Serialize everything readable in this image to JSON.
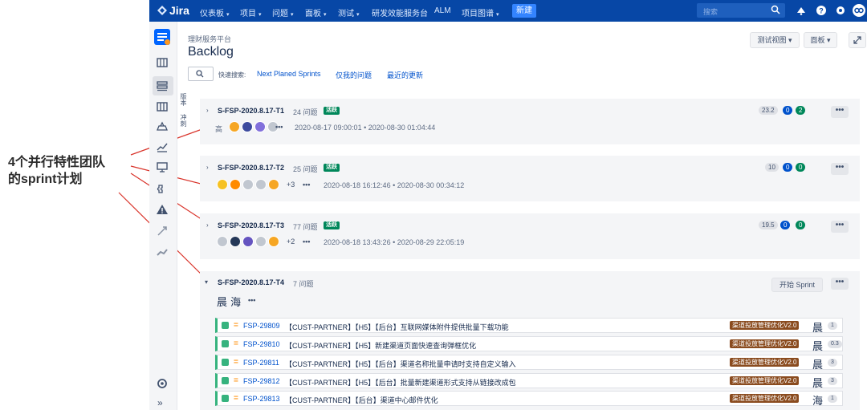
{
  "nav": {
    "logo": "Jira",
    "items": [
      "仪表板",
      "项目",
      "问题",
      "面板",
      "测试",
      "研发效能服务台",
      "ALM",
      "项目图谱"
    ],
    "create_label": "新建",
    "search_placeholder": "搜索",
    "icons": [
      "search-icon",
      "bell-icon",
      "help-icon",
      "gear-icon",
      "avatar-icon"
    ]
  },
  "header": {
    "breadcrumb": "理财服务平台",
    "title": "Backlog",
    "view_button": "测试视图",
    "board_button": "面板",
    "quick_search_label": "快速搜索:",
    "quick_filters": [
      "Next Planed Sprints",
      "仅我的问题",
      "最近的更新"
    ]
  },
  "side_tabs": [
    "版本",
    "冲刺"
  ],
  "annotation": {
    "line1": "4个并行特性团队",
    "line2": "的sprint计划",
    "arrow_color": "#d9342b"
  },
  "sprints": [
    {
      "name": "S-FSP-2020.8.17-T1",
      "count": "24 问题",
      "status": "活跃",
      "assignee_label": "高",
      "more_avatars": "",
      "dates": "2020-08-17 09:00:01 • 2020-08-30 01:04:44",
      "points": [
        "23.2",
        "0",
        "2"
      ]
    },
    {
      "name": "S-FSP-2020.8.17-T2",
      "count": "25 问题",
      "status": "活跃",
      "assignee_label": "",
      "more_avatars": "+3",
      "dates": "2020-08-18 16:12:46 • 2020-08-30 00:34:12",
      "points": [
        "10",
        "0",
        "0"
      ]
    },
    {
      "name": "S-FSP-2020.8.17-T3",
      "count": "77 问题",
      "status": "活跃",
      "assignee_label": "",
      "more_avatars": "+2",
      "dates": "2020-08-18 13:43:26 • 2020-08-29 22:05:19",
      "points": [
        "19.5",
        "0",
        "0"
      ]
    },
    {
      "name": "S-FSP-2020.8.17-T4",
      "count": "7 问题",
      "status": "",
      "assignee_label": "晨 海",
      "start_button": "开始 Sprint",
      "issues": [
        {
          "key": "FSP-29809",
          "summary": "【CUST-PARTNER】【H5】【后台】互联网媒体附件提供批量下载功能",
          "epic": "渠道投放管理优化V2.0",
          "assignee": "晨",
          "estimate": "1"
        },
        {
          "key": "FSP-29810",
          "summary": "【CUST-PARTNER】【H5】新建渠道页面快速查询弹框优化",
          "epic": "渠道投放管理优化V2.0",
          "assignee": "晨",
          "estimate": "0.3"
        },
        {
          "key": "FSP-29811",
          "summary": "【CUST-PARTNER】【H5】【后台】渠道名称批量申请时支持自定义输入",
          "epic": "渠道投放管理优化V2.0",
          "assignee": "晨",
          "estimate": "3"
        },
        {
          "key": "FSP-29812",
          "summary": "【CUST-PARTNER】【H5】【后台】批量新建渠道形式支持从链接改成包",
          "epic": "渠道投放管理优化V2.0",
          "assignee": "晨",
          "estimate": "3"
        },
        {
          "key": "FSP-29813",
          "summary": "【CUST-PARTNER】【后台】渠道中心邮件优化",
          "epic": "渠道投放管理优化V2.0",
          "assignee": "海",
          "estimate": "1"
        }
      ]
    }
  ]
}
